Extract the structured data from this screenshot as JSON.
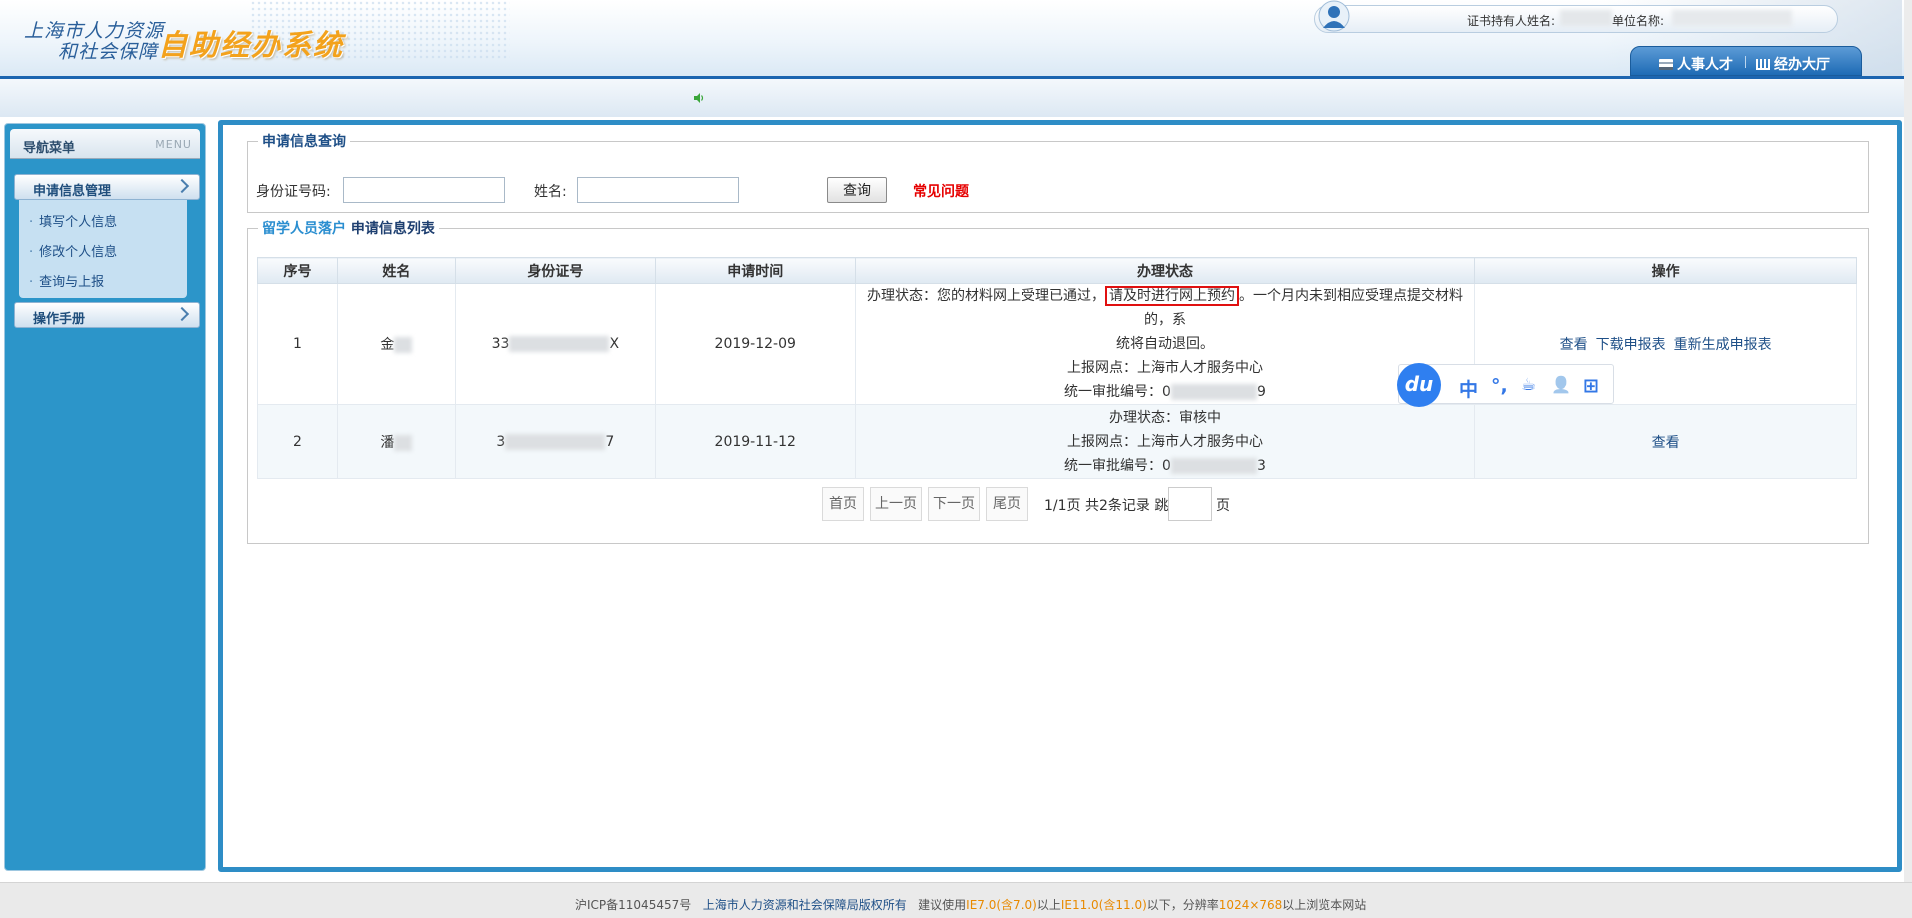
{
  "header": {
    "logo_line1": "上海市人力资源",
    "logo_line2": "和社会保障",
    "logo_system": "自助经办系统",
    "cert_holder_label": "证书持有人姓名:",
    "unit_name_label": "单位名称:",
    "tabs": [
      {
        "label": "人事人才",
        "icon": "id-card-icon"
      },
      {
        "label": "经办大厅",
        "icon": "building-icon"
      }
    ]
  },
  "sidebar": {
    "title": "导航菜单",
    "title_en": "MENU",
    "sections": [
      {
        "label": "申请信息管理",
        "items": [
          "填写个人信息",
          "修改个人信息",
          "查询与上报"
        ]
      },
      {
        "label": "操作手册"
      }
    ]
  },
  "query": {
    "legend": "申请信息查询",
    "id_label": "身份证号码:",
    "id_value": "",
    "name_label": "姓名:",
    "name_value": "",
    "button": "查询",
    "faq": "常见问题"
  },
  "list": {
    "legend_a": "留学人员落户",
    "legend_b": "申请信息列表",
    "columns": [
      "序号",
      "姓名",
      "身份证号",
      "申请时间",
      "办理状态",
      "操作"
    ],
    "rows": [
      {
        "index": "1",
        "name_visible": "金",
        "id_prefix": "33",
        "id_suffix": "X",
        "date": "2019-12-09",
        "status_pre": "办理状态：您的材料网上受理已通过，",
        "status_highlight": "请及时进行网上预约",
        "status_post": "。一个月内未到相应受理点提交材料的，系",
        "status_line2": "统将自动退回。",
        "report_site": "上报网点：上海市人才服务中心",
        "approval_prefix": "统一审批编号：0",
        "approval_suffix": "9",
        "actions": [
          "查看",
          "下载申报表",
          "重新生成申报表"
        ]
      },
      {
        "index": "2",
        "name_visible": "潘",
        "id_prefix": "3",
        "id_suffix": "7",
        "date": "2019-11-12",
        "status": "办理状态：审核中",
        "report_site": "上报网点：上海市人才服务中心",
        "approval_prefix": "统一审批编号：0",
        "approval_suffix": "3",
        "actions": [
          "查看"
        ]
      }
    ]
  },
  "pager": {
    "first": "首页",
    "prev": "上一页",
    "next": "下一页",
    "last": "尾页",
    "info": "1/1页 共2条记录 跳到第",
    "page_suffix": "页"
  },
  "ime": {
    "logo": "du",
    "items": [
      "中",
      "°,",
      "☕",
      "👤",
      "⊞"
    ]
  },
  "footer": {
    "icp": "沪ICP备11045457号",
    "copyright": "上海市人力资源和社会保障局版权所有",
    "t1": "建议使用",
    "ie7": "IE7.0(含7.0)",
    "t2": "以上",
    "ie11": "IE11.0(含11.0)",
    "t3": "以下，分辨率",
    "res": "1024×768",
    "t4": "以上浏览本网站"
  },
  "colors": {
    "brand_blue": "#2e8dc6",
    "logo_orange": "#f3a21c",
    "faq_red": "#e60000",
    "highlight_border": "#e01010"
  }
}
